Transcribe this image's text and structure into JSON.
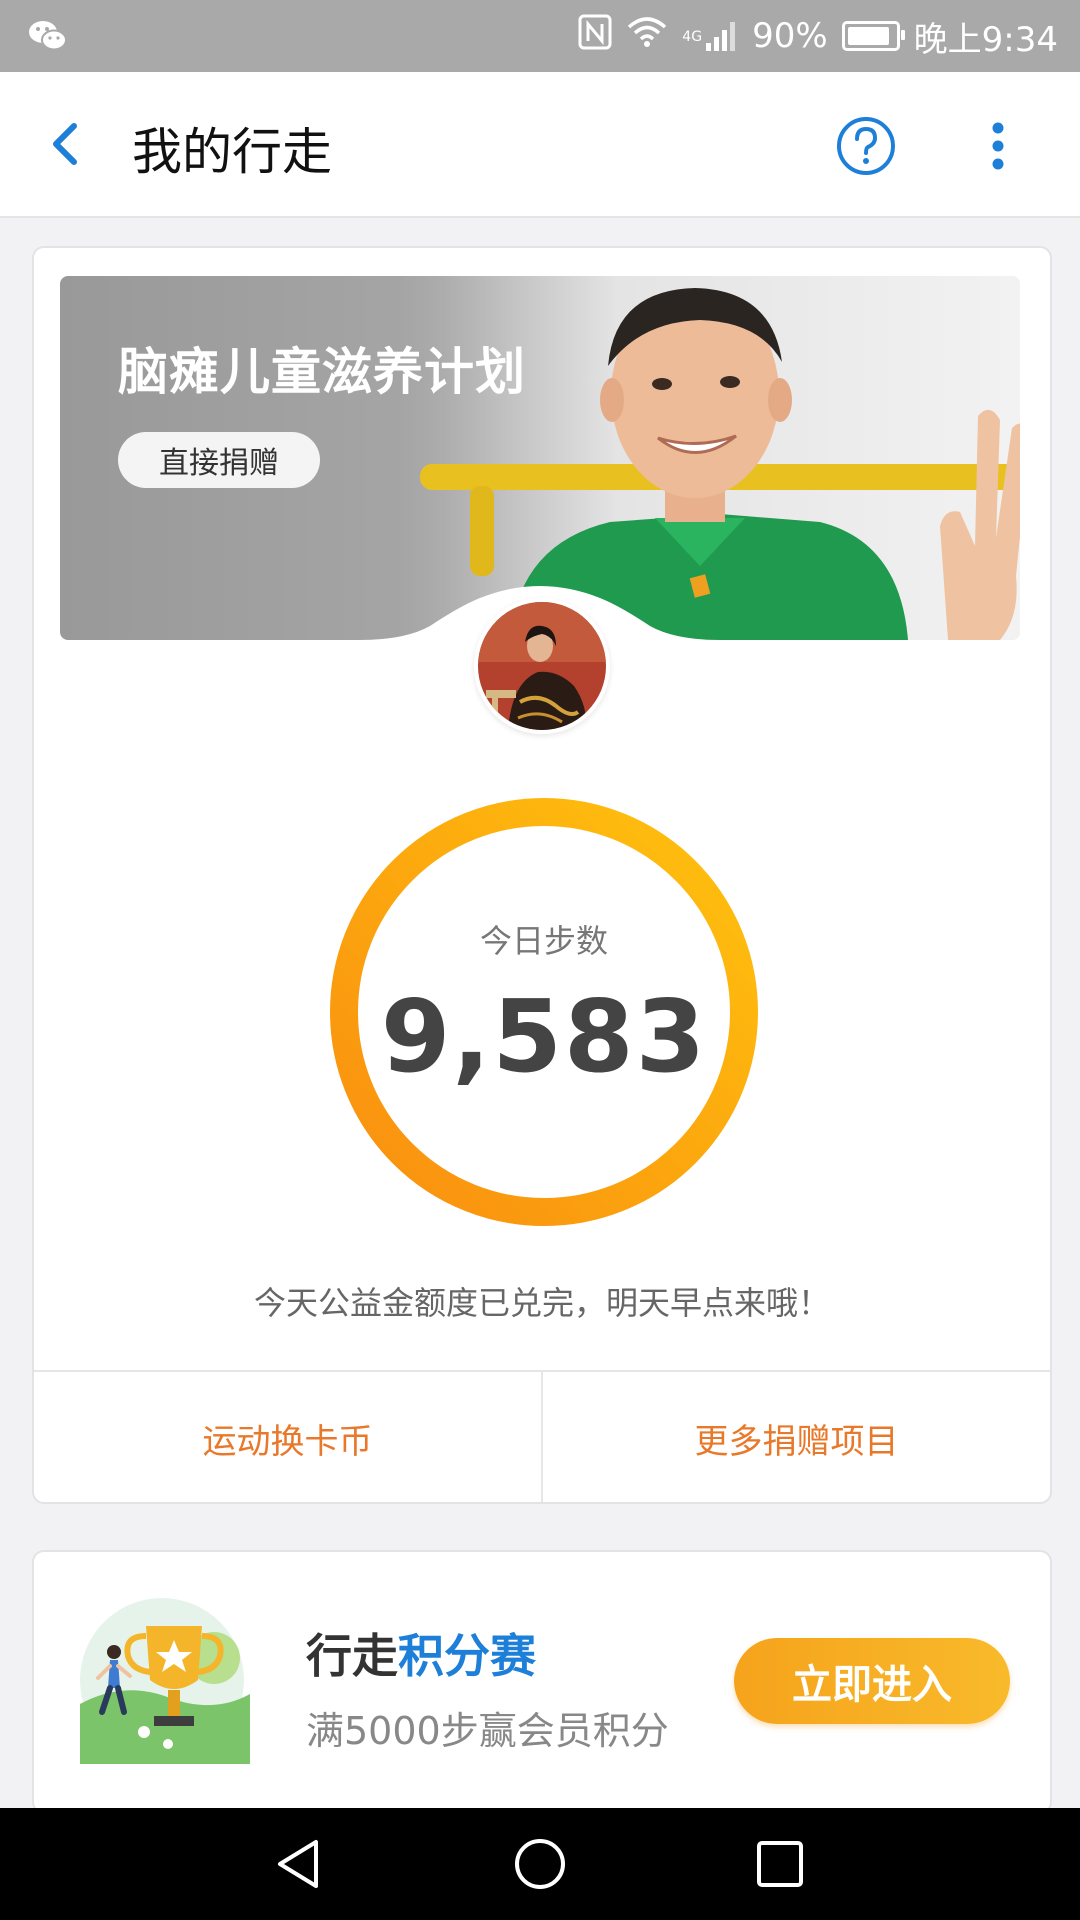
{
  "status_bar": {
    "battery_text": "90%",
    "battery_level": 0.9,
    "network_label": "4G",
    "time": "晚上9:34"
  },
  "header": {
    "title": "我的行走"
  },
  "banner": {
    "title": "脑瘫儿童滋养计划",
    "donate_label": "直接捐赠"
  },
  "steps": {
    "label": "今日步数",
    "value": "9,583"
  },
  "notice": "今天公益金额度已兑完，明天早点来哦！",
  "actions": [
    {
      "label": "运动换卡币"
    },
    {
      "label": "更多捐赠项目"
    }
  ],
  "promo": {
    "title_part1": "行走",
    "title_part2": "积分赛",
    "subtitle": "满5000步赢会员积分",
    "button_label": "立即进入"
  },
  "colors": {
    "accent_blue": "#1e7fd8",
    "action_orange": "#e8782a",
    "ring_start": "#f98e0f",
    "ring_end": "#ffc20e"
  }
}
